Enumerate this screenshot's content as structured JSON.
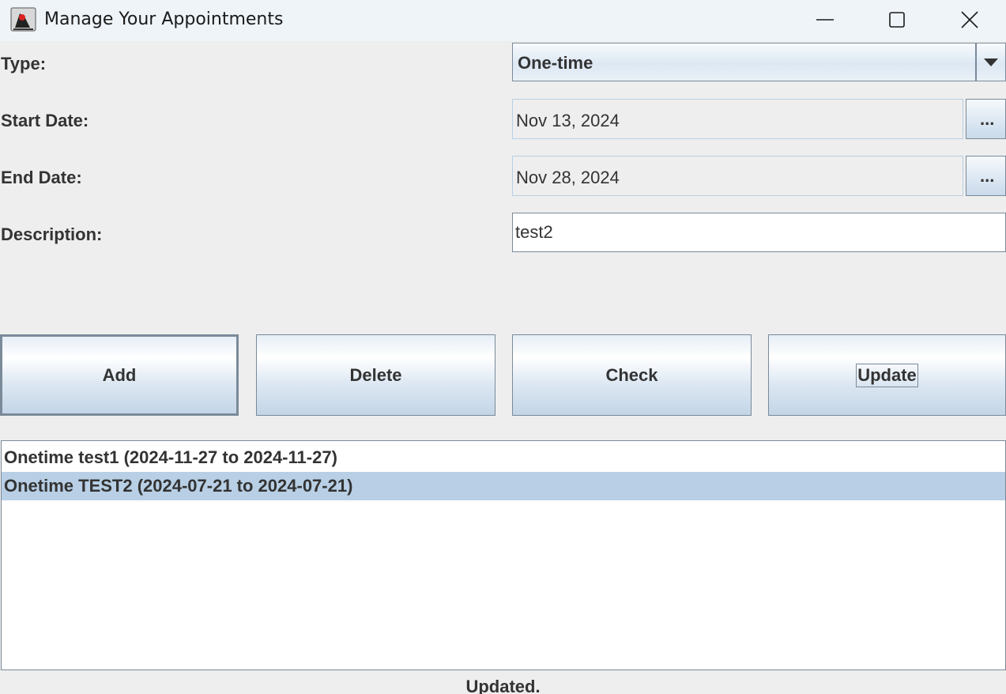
{
  "window": {
    "title": "Manage Your Appointments",
    "icon": "java-duke-icon"
  },
  "form": {
    "type_label": "Type:",
    "type_value": "One-time",
    "start_label": "Start Date:",
    "start_value": "Nov 13, 2024",
    "end_label": "End Date:",
    "end_value": "Nov 28, 2024",
    "picker_label": "...",
    "description_label": "Description:",
    "description_value": "test2"
  },
  "buttons": {
    "add": "Add",
    "delete": "Delete",
    "check": "Check",
    "update": "Update"
  },
  "appointments": [
    {
      "text": "Onetime test1 (2024-11-27 to 2024-11-27)",
      "selected": false
    },
    {
      "text": "Onetime TEST2 (2024-07-21 to 2024-07-21)",
      "selected": true
    }
  ],
  "status": "Updated.",
  "colors": {
    "selection": "#b8cfe5",
    "border": "#7a8a99",
    "titlebar": "#eff4f9"
  }
}
